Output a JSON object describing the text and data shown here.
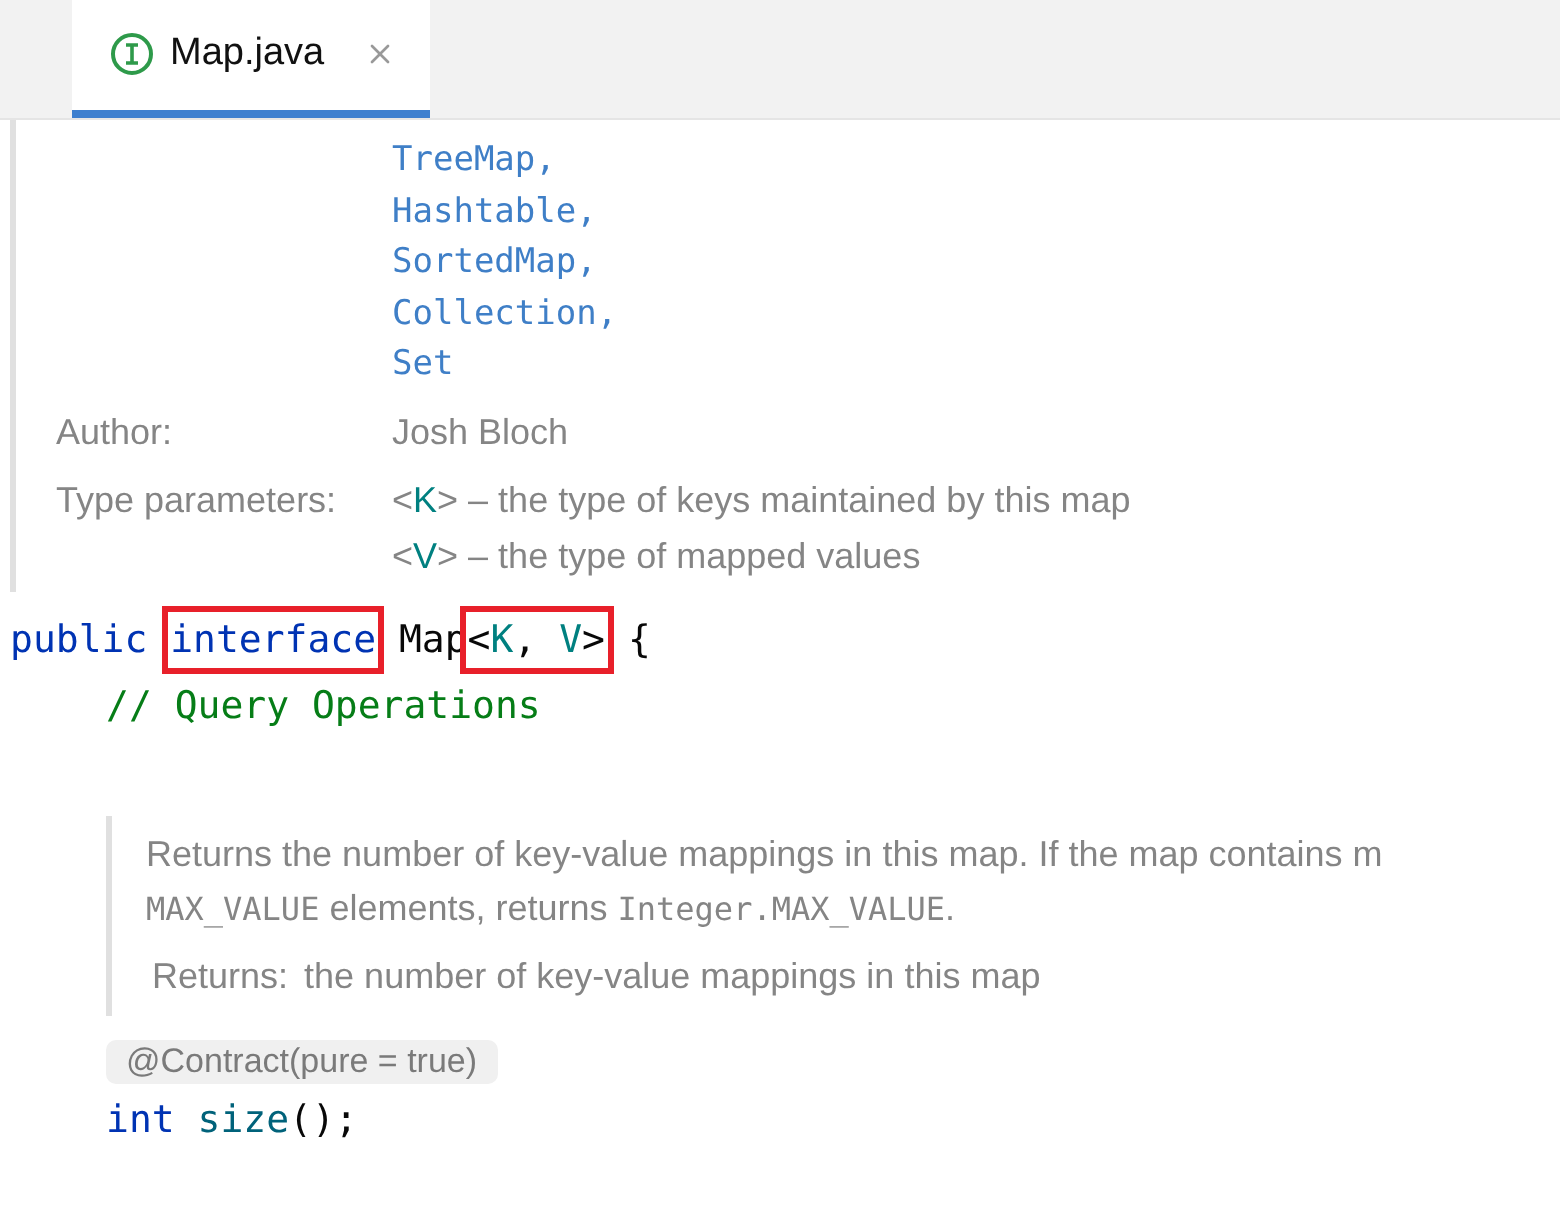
{
  "tabs": [
    {
      "label": "Map.java",
      "selected": true
    }
  ],
  "doc_top": {
    "see_also": [
      "TreeMap,",
      "Hashtable,",
      "SortedMap,",
      "Collection,",
      "Set"
    ],
    "fields": [
      {
        "label": "Author:",
        "lines": [
          {
            "segments": [
              {
                "kind": "text",
                "text": "Josh Bloch"
              }
            ]
          }
        ]
      },
      {
        "label": "Type parameters:",
        "lines": [
          {
            "segments": [
              {
                "kind": "text",
                "text": "<"
              },
              {
                "kind": "param",
                "text": "K"
              },
              {
                "kind": "text",
                "text": "> – the type of keys maintained by this map"
              }
            ]
          },
          {
            "segments": [
              {
                "kind": "text",
                "text": "<"
              },
              {
                "kind": "param",
                "text": "V"
              },
              {
                "kind": "text",
                "text": "> – the type of mapped values"
              }
            ]
          }
        ]
      }
    ]
  },
  "code_before": [
    {
      "indent": false,
      "parts": [
        {
          "boxed": false,
          "tokens": [
            {
              "kind": "keyword",
              "text": "public "
            }
          ]
        },
        {
          "boxed": true,
          "tokens": [
            {
              "kind": "keyword",
              "text": "interface"
            }
          ]
        },
        {
          "boxed": false,
          "tokens": [
            {
              "kind": "plain",
              "text": " Map"
            }
          ]
        },
        {
          "boxed": true,
          "tokens": [
            {
              "kind": "plain",
              "text": "<"
            },
            {
              "kind": "param",
              "text": "K"
            },
            {
              "kind": "plain",
              "text": ", "
            },
            {
              "kind": "param",
              "text": "V"
            },
            {
              "kind": "plain",
              "text": ">"
            }
          ]
        },
        {
          "boxed": false,
          "tokens": [
            {
              "kind": "plain",
              "text": " {"
            }
          ]
        }
      ]
    },
    {
      "indent": true,
      "parts": [
        {
          "boxed": false,
          "tokens": [
            {
              "kind": "comment",
              "text": "// Query Operations"
            }
          ]
        }
      ]
    }
  ],
  "doc_method": {
    "paragraph": [
      {
        "kind": "text",
        "text": "Returns the number of key-value mappings in this map. If the map contains m"
      }
    ],
    "paragraph_2": [
      {
        "kind": "code",
        "text": "MAX_VALUE"
      },
      {
        "kind": "text",
        "text": " elements, returns "
      },
      {
        "kind": "code",
        "text": "Integer.MAX_VALUE"
      },
      {
        "kind": "text",
        "text": "."
      }
    ],
    "returns_label": "Returns:",
    "returns_text": "the number of key-value mappings in this map"
  },
  "annotation": "@Contract(pure = true)",
  "code_after": [
    {
      "indent": true,
      "parts": [
        {
          "boxed": false,
          "tokens": [
            {
              "kind": "keyword",
              "text": "int"
            },
            {
              "kind": "method",
              "text": " size"
            },
            {
              "kind": "plain",
              "text": "();"
            }
          ]
        }
      ]
    }
  ]
}
